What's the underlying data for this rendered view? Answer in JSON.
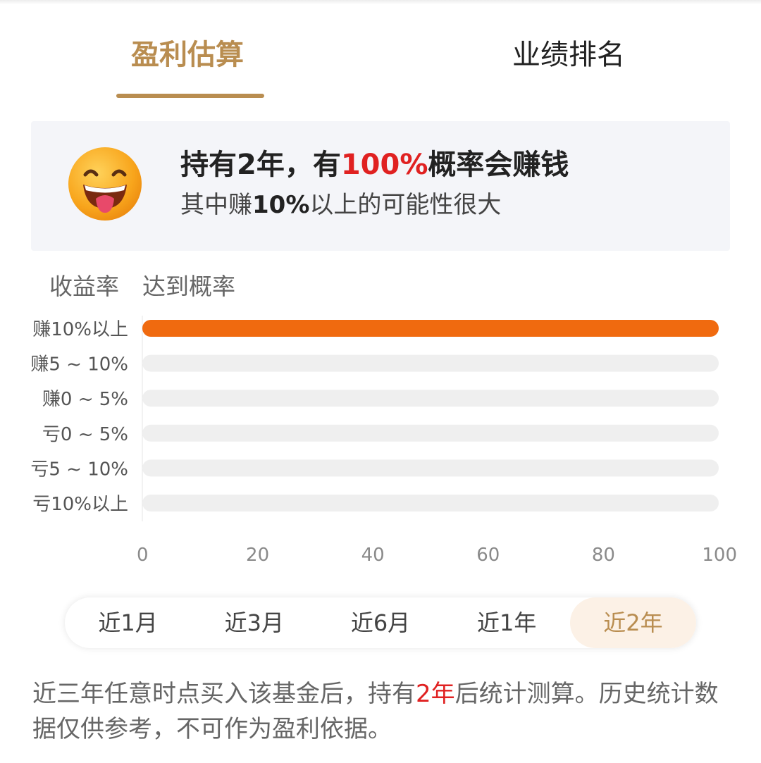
{
  "tabs": [
    {
      "label": "盈利估算",
      "active": true
    },
    {
      "label": "业绩排名",
      "active": false
    }
  ],
  "accent_color": "#b98d50",
  "bar_color": "#f06a0f",
  "track_color": "#efefef",
  "summary": {
    "line1_prefix": "持有2年，有",
    "line1_highlight": "100%",
    "line1_suffix": "概率会赚钱",
    "line2_prefix": "其中赚",
    "line2_bold": "10%",
    "line2_suffix": "以上的可能性很大",
    "icon": "smiling-face-icon"
  },
  "chart_header": {
    "rate": "收益率",
    "probability": "达到概率"
  },
  "chart_data": {
    "type": "bar",
    "orientation": "horizontal",
    "categories": [
      "赚10%以上",
      "赚5 ~ 10%",
      "赚0 ~ 5%",
      "亏0 ~ 5%",
      "亏5 ~ 10%",
      "亏10%以上"
    ],
    "values": [
      100,
      0,
      0,
      0,
      0,
      0
    ],
    "xlim": [
      0,
      100
    ],
    "xticks": [
      "0",
      "20",
      "40",
      "60",
      "80",
      "100"
    ],
    "grid": false,
    "legend": "none"
  },
  "periods": [
    {
      "label": "近1月",
      "active": false
    },
    {
      "label": "近3月",
      "active": false
    },
    {
      "label": "近6月",
      "active": false
    },
    {
      "label": "近1年",
      "active": false
    },
    {
      "label": "近2年",
      "active": true
    }
  ],
  "footnote": {
    "prefix": "近三年任意时点买入该基金后，持有",
    "highlight": "2年",
    "suffix": "后统计测算。历史统计数据仅供参考，不可作为盈利依据。"
  }
}
